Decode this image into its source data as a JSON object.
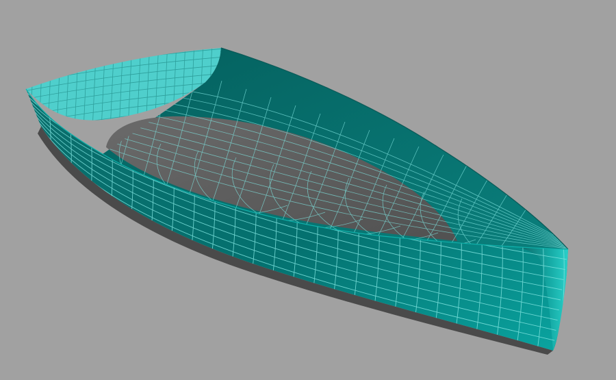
{
  "viewport": {
    "background": "#a1a1a1",
    "model": "boat-hull",
    "render_mode": "shaded-with-wireframe",
    "colors": {
      "hull_exterior": "#008080",
      "hull_interior": "#0a7a78",
      "transom": "#4fcfcc",
      "deck_floor": "#5e5e5e",
      "wire": "#7fe3df",
      "keel_shadow": "#4a4a4a"
    }
  }
}
